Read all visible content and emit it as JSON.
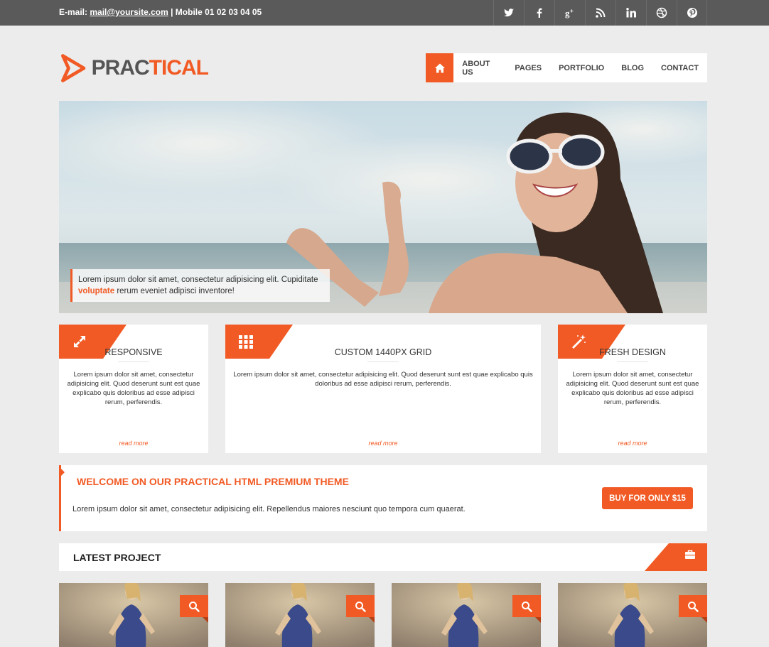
{
  "topbar": {
    "email_label": "E-mail:",
    "email": "mail@yoursite.com",
    "mobile": "| Mobile 01 02 03 04 05",
    "social": [
      "twitter-icon",
      "facebook-icon",
      "google-plus-icon",
      "rss-icon",
      "linkedin-icon",
      "dribbble-icon",
      "pinterest-icon"
    ]
  },
  "logo": {
    "part1": "PRAC",
    "part2": "TICAL"
  },
  "nav": {
    "home_icon": "home-icon",
    "items": [
      "ABOUT US",
      "PAGES",
      "PORTFOLIO",
      "BLOG",
      "CONTACT"
    ]
  },
  "hero": {
    "caption_start": "Lorem ipsum dolor sit amet, consectetur adipisicing elit. Cupiditate",
    "caption_highlight": "voluptate",
    "caption_end": " rerum eveniet adipisci inventore!"
  },
  "features": [
    {
      "icon": "expand-icon",
      "title": "RESPONSIVE",
      "text": "Lorem ipsum dolor sit amet, consectetur adipisicing elit. Quod deserunt sunt est quae explicabo quis doloribus ad esse adipisci rerum, perferendis.",
      "more": "read more"
    },
    {
      "icon": "grid-icon",
      "title": "CUSTOM 1440PX GRID",
      "text": "Lorem ipsum dolor sit amet, consectetur adipisicing elit. Quod deserunt sunt est quae explicabo quis doloribus ad esse adipisci rerum, perferendis.",
      "more": "read more"
    },
    {
      "icon": "magic-wand-icon",
      "title": "FRESH DESIGN",
      "text": "Lorem ipsum dolor sit amet, consectetur adipisicing elit. Quod deserunt sunt est quae explicabo quis doloribus ad esse adipisci rerum, perferendis.",
      "more": "read more"
    }
  ],
  "welcome": {
    "title": "WELCOME ON OUR PRACTICAL HTML PREMIUM THEME",
    "text": "Lorem ipsum dolor sit amet, consectetur adipisicing elit. Repellendus maiores nesciunt quo tempora cum quaerat.",
    "buy_label": "BUY FOR ONLY $15"
  },
  "latest": {
    "title": "LATEST PROJECT",
    "icon": "briefcase-icon"
  },
  "projects": [
    {
      "icon": "search-icon"
    },
    {
      "icon": "search-icon"
    },
    {
      "icon": "search-icon"
    },
    {
      "icon": "search-icon"
    }
  ],
  "colors": {
    "accent": "#f15a24",
    "topbar": "#5a5a5a",
    "page_bg": "#ececec"
  }
}
